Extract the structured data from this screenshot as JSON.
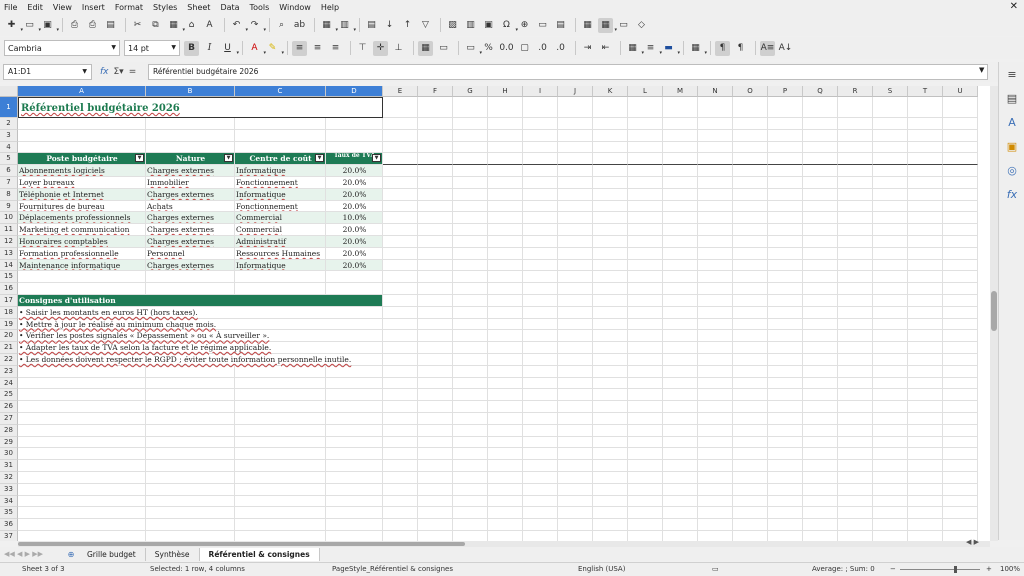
{
  "menu": [
    "File",
    "Edit",
    "View",
    "Insert",
    "Format",
    "Styles",
    "Sheet",
    "Data",
    "Tools",
    "Window",
    "Help"
  ],
  "font": {
    "name": "Cambria",
    "size": "14 pt"
  },
  "name_box": "A1:D1",
  "formula": "Référentiel budgétaire 2026",
  "columns": [
    "A",
    "B",
    "C",
    "D",
    "E",
    "F",
    "G",
    "H",
    "I",
    "J",
    "K",
    "L",
    "M",
    "N",
    "O",
    "P",
    "Q",
    "R",
    "S",
    "T",
    "U"
  ],
  "title": "Référentiel budgétaire 2026",
  "headers": [
    "Poste budgétaire",
    "Nature",
    "Centre de coût",
    "Taux de TVA"
  ],
  "rows": [
    [
      "Abonnements logiciels",
      "Charges externes",
      "Informatique",
      "20.0%"
    ],
    [
      "Loyer bureaux",
      "Immobilier",
      "Fonctionnement",
      "20.0%"
    ],
    [
      "Téléphonie et Internet",
      "Charges externes",
      "Informatique",
      "20.0%"
    ],
    [
      "Fournitures de bureau",
      "Achats",
      "Fonctionnement",
      "20.0%"
    ],
    [
      "Déplacements professionnels",
      "Charges externes",
      "Commercial",
      "10.0%"
    ],
    [
      "Marketing et communication",
      "Charges externes",
      "Commercial",
      "20.0%"
    ],
    [
      "Honoraires comptables",
      "Charges externes",
      "Administratif",
      "20.0%"
    ],
    [
      "Formation professionnelle",
      "Personnel",
      "Ressources Humaines",
      "20.0%"
    ],
    [
      "Maintenance informatique",
      "Charges externes",
      "Informatique",
      "20.0%"
    ]
  ],
  "consignes_title": "Consignes d'utilisation",
  "consignes": [
    "• Saisir les montants en euros HT (hors taxes).",
    "• Mettre à jour le réalisé au minimum chaque mois.",
    "• Vérifier les postes signalés « Dépassement » ou « À surveiller ».",
    "• Adapter les taux de TVA selon la facture et le régime applicable.",
    "• Les données doivent respecter le RGPD ; éviter toute information personnelle inutile."
  ],
  "tabs": [
    "Grille budget",
    "Synthèse",
    "Référentiel & consignes"
  ],
  "active_tab": 2,
  "status": {
    "sheet": "Sheet 3 of 3",
    "selection": "Selected: 1 row, 4 columns",
    "pagestyle": "PageStyle_Référentiel & consignes",
    "language": "English (USA)",
    "sum": "Average: ; Sum: 0",
    "zoom": "100%"
  }
}
